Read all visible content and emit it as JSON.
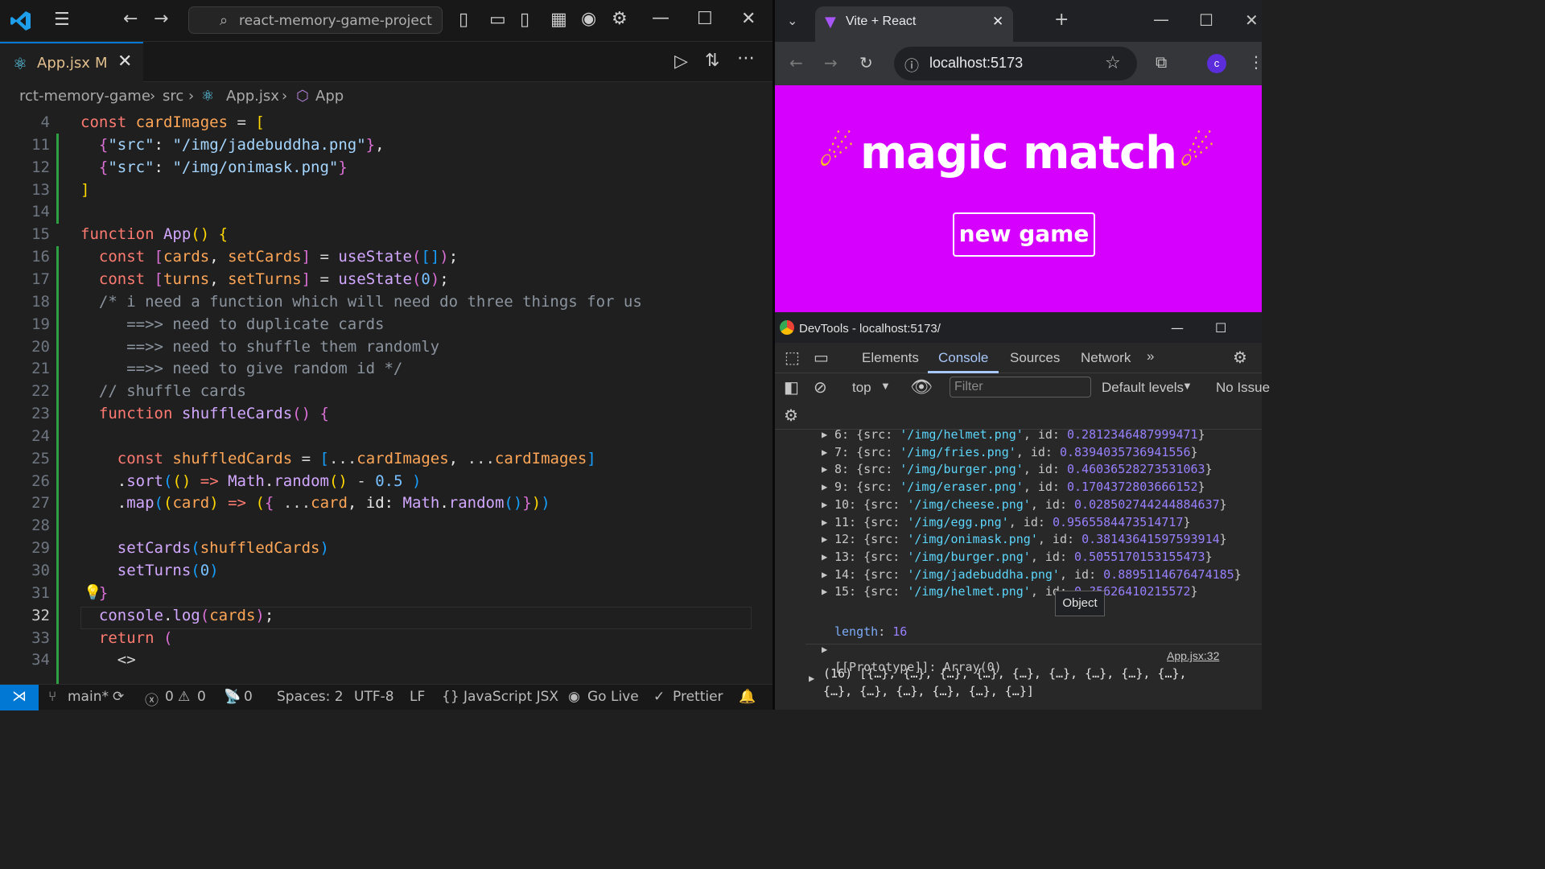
{
  "vscode": {
    "search_text": "react-memory-game-project",
    "tab": {
      "name": "App.jsx",
      "status": "M"
    },
    "breadcrumb": [
      "rct-memory-game",
      "src",
      "App.jsx",
      "App"
    ],
    "code_lines": [
      {
        "n": "4",
        "html": "<span class=\"kc\">const</span> <span class=\"vr\">cardImages</span> <span class=\"o\">=</span> <span class=\"br1\">[</span>"
      },
      {
        "n": "11",
        "html": "  <span class=\"br2\">{</span><span class=\"str\">\"src\"</span>: <span class=\"str\">\"/img/jadebuddha.png\"</span><span class=\"br2\">}</span>,"
      },
      {
        "n": "12",
        "html": "  <span class=\"br2\">{</span><span class=\"str\">\"src\"</span>: <span class=\"str\">\"/img/onimask.png\"</span><span class=\"br2\">}</span>"
      },
      {
        "n": "13",
        "html": "<span class=\"br1\">]</span>"
      },
      {
        "n": "14",
        "html": ""
      },
      {
        "n": "15",
        "html": "<span class=\"kc\">function</span> <span class=\"fn\">App</span><span class=\"br1\">()</span> <span class=\"br1\">{</span>"
      },
      {
        "n": "16",
        "html": "  <span class=\"kc\">const</span> <span class=\"br2\">[</span><span class=\"vr\">cards</span>, <span class=\"vr\">setCards</span><span class=\"br2\">]</span> <span class=\"o\">=</span> <span class=\"fn\">useState</span><span class=\"br2\">(</span><span class=\"br3\">[]</span><span class=\"br2\">)</span>;"
      },
      {
        "n": "17",
        "html": "  <span class=\"kc\">const</span> <span class=\"br2\">[</span><span class=\"vr\">turns</span>, <span class=\"vr\">setTurns</span><span class=\"br2\">]</span> <span class=\"o\">=</span> <span class=\"fn\">useState</span><span class=\"br2\">(</span><span class=\"num\">0</span><span class=\"br2\">)</span>;"
      },
      {
        "n": "18",
        "html": "  <span class=\"cm\">/* i need a function which will need do three things for us</span>"
      },
      {
        "n": "19",
        "html": "<span class=\"cm\">     ==&gt;&gt; need to duplicate cards</span>"
      },
      {
        "n": "20",
        "html": "<span class=\"cm\">     ==&gt;&gt; need to shuffle them randomly</span>"
      },
      {
        "n": "21",
        "html": "<span class=\"cm\">     ==&gt;&gt; need to give random id */</span>"
      },
      {
        "n": "22",
        "html": "  <span class=\"cm\">// shuffle cards</span>"
      },
      {
        "n": "23",
        "html": "  <span class=\"kc\">function</span> <span class=\"fn\">shuffleCards</span><span class=\"br2\">()</span> <span class=\"br2\">{</span>"
      },
      {
        "n": "24",
        "html": ""
      },
      {
        "n": "25",
        "html": "    <span class=\"kc\">const</span> <span class=\"vr\">shuffledCards</span> <span class=\"o\">=</span> <span class=\"br3\">[</span><span class=\"o\">...</span><span class=\"vr\">cardImages</span>, <span class=\"o\">...</span><span class=\"vr\">cardImages</span><span class=\"br3\">]</span>"
      },
      {
        "n": "26",
        "html": "    .<span class=\"fn\">sort</span><span class=\"br3\">(</span><span class=\"br1\">()</span> <span class=\"kc\">=&gt;</span> <span class=\"fn\">Math</span>.<span class=\"fn\">random</span><span class=\"br1\">()</span> <span class=\"o\">-</span> <span class=\"num\">0.5</span> <span class=\"br3\">)</span>"
      },
      {
        "n": "27",
        "html": "    .<span class=\"fn\">map</span><span class=\"br3\">(</span><span class=\"br1\">(</span><span class=\"vr\">card</span><span class=\"br1\">)</span> <span class=\"kc\">=&gt;</span> <span class=\"br1\">(</span><span class=\"br2\">{</span> <span class=\"o\">...</span><span class=\"vr\">card</span>, id: <span class=\"fn\">Math</span>.<span class=\"fn\">random</span><span class=\"br3\">()</span><span class=\"br2\">}</span><span class=\"br1\">)</span><span class=\"br3\">)</span>"
      },
      {
        "n": "28",
        "html": ""
      },
      {
        "n": "29",
        "html": "    <span class=\"fn\">setCards</span><span class=\"br3\">(</span><span class=\"vr\">shuffledCards</span><span class=\"br3\">)</span>"
      },
      {
        "n": "30",
        "html": "    <span class=\"fn\">setTurns</span><span class=\"br3\">(</span><span class=\"num\">0</span><span class=\"br3\">)</span>"
      },
      {
        "n": "31",
        "html": "  <span class=\"br2\">}</span>"
      },
      {
        "n": "32",
        "html": "  <span class=\"fn\">console</span>.<span class=\"fn\">log</span><span class=\"br2\">(</span><span class=\"vr\">cards</span><span class=\"br2\">)</span>;"
      },
      {
        "n": "33",
        "html": "  <span class=\"kc\">return</span> <span class=\"br2\">(</span>"
      },
      {
        "n": "34",
        "html": "    <span class=\"o\">&lt;&gt;</span>"
      }
    ],
    "current_line": "32",
    "status": {
      "branch": "main*",
      "errors": "0",
      "warnings": "0",
      "ports": "0",
      "spaces": "Spaces: 2",
      "encoding": "UTF-8",
      "eol": "LF",
      "language": "JavaScript JSX",
      "golive": "Go Live",
      "prettier": "Prettier"
    }
  },
  "browser": {
    "tab_title": "Vite + React",
    "url": "localhost:5173",
    "profile_initial": "c",
    "page": {
      "title": "magic match",
      "button": "new game",
      "bg_color": "#d600ff"
    }
  },
  "devtools": {
    "title": "DevTools - localhost:5173/",
    "tabs": [
      "Elements",
      "Console",
      "Sources",
      "Network"
    ],
    "context": "top",
    "filter_placeholder": "Filter",
    "levels": "Default levels",
    "issues": "No Issue",
    "entries": [
      {
        "i": "6",
        "src": "'/img/helmet.png'",
        "id": "0.2812346487999471"
      },
      {
        "i": "7",
        "src": "'/img/fries.png'",
        "id": "0.8394035736941556"
      },
      {
        "i": "8",
        "src": "'/img/burger.png'",
        "id": "0.46036528273531063"
      },
      {
        "i": "9",
        "src": "'/img/eraser.png'",
        "id": "0.1704372803666152"
      },
      {
        "i": "10",
        "src": "'/img/cheese.png'",
        "id": "0.028502744244884637"
      },
      {
        "i": "11",
        "src": "'/img/egg.png'",
        "id": "0.9565584473514717"
      },
      {
        "i": "12",
        "src": "'/img/onimask.png'",
        "id": "0.381436415975939​14"
      },
      {
        "i": "13",
        "src": "'/img/burger.png'",
        "id": "0.5055170153155473"
      },
      {
        "i": "14",
        "src": "'/img/jadebuddha.png'",
        "id": "0.8895114676474185"
      },
      {
        "i": "15",
        "src": "'/img/helmet.png'",
        "id": "0.?56264102155​72"
      }
    ],
    "length_label": "length",
    "length": "16",
    "prototype": "[[Prototype]]: Array(0)",
    "source_link": "App.jsx:32",
    "summary_1": "(16) [{…}, {…}, {…}, {…}, {…}, {…}, {…}, {…}, {…},",
    "summary_2": "{…}, {…}, {…}, {…}, {…}, {…}]",
    "tooltip": "Object"
  }
}
